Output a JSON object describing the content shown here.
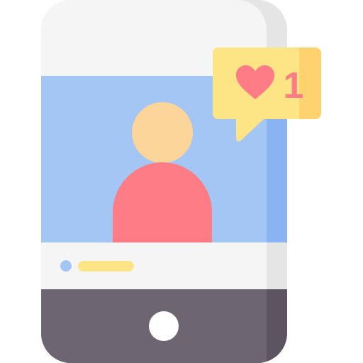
{
  "icon": "smartphone-social-post-like-notification",
  "notification": {
    "icon": "heart-icon",
    "count": "1"
  },
  "colors": {
    "phone_body": "#f5f5f5",
    "phone_shade": "#e5e5e5",
    "screen": "#a4c6f4",
    "screen_shade": "#8ab3f4",
    "avatar_head": "#fcd59b",
    "avatar_body": "#fe7c85",
    "bottom_bar": "#6d6672",
    "bottom_bar_shade": "#5c5561",
    "home_button": "#ffffff",
    "caption_dot": "#a4c6f4",
    "caption_bar": "#fde484",
    "bubble": "#fde484",
    "bubble_shade": "#fed36f",
    "heart": "#fe7c85"
  }
}
